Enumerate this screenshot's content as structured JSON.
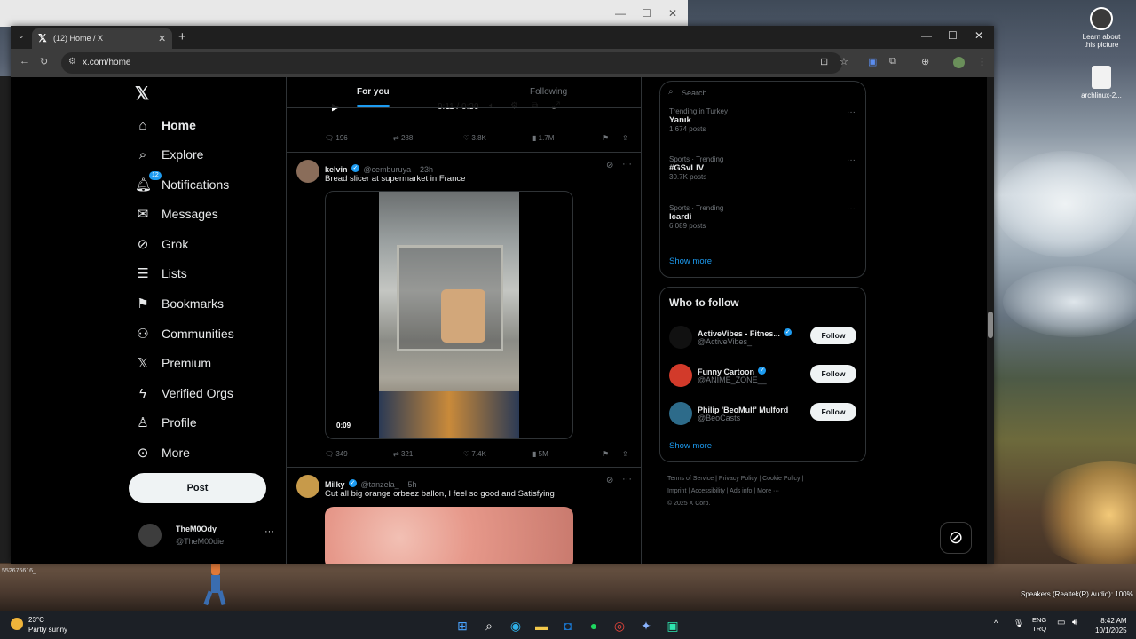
{
  "browser": {
    "tab_title": "(12) Home / X",
    "url": "x.com/home"
  },
  "nav": {
    "items": [
      {
        "label": "Home",
        "icon": "home-icon"
      },
      {
        "label": "Explore",
        "icon": "search-icon"
      },
      {
        "label": "Notifications",
        "icon": "bell-icon"
      },
      {
        "label": "Messages",
        "icon": "mail-icon"
      },
      {
        "label": "Grok",
        "icon": "grok-icon"
      },
      {
        "label": "Lists",
        "icon": "list-icon"
      },
      {
        "label": "Bookmarks",
        "icon": "bookmark-icon"
      },
      {
        "label": "Communities",
        "icon": "people-icon"
      },
      {
        "label": "Premium",
        "icon": "x-logo-icon"
      },
      {
        "label": "Verified Orgs",
        "icon": "lightning-icon"
      },
      {
        "label": "Profile",
        "icon": "person-icon"
      },
      {
        "label": "More",
        "icon": "more-circle-icon"
      }
    ],
    "notifications_badge": "12",
    "post_label": "Post",
    "account": {
      "name": "TheM0Ody",
      "handle": "@TheM00die"
    }
  },
  "timeline": {
    "tabs": [
      "For you",
      "Following"
    ],
    "top_player": {
      "time": "0:11 / 0:30"
    },
    "top_actions": {
      "replies": "196",
      "reposts": "288",
      "likes": "3.8K",
      "views": "1.7M"
    },
    "tweets": [
      {
        "name": "kelvin",
        "handle": "@cemburuya",
        "time": "· 23h",
        "text": "Bread slicer at supermarket in France",
        "video_time": "0:09",
        "actions": {
          "replies": "349",
          "reposts": "321",
          "likes": "7.4K",
          "views": "5M"
        }
      },
      {
        "name": "Milky",
        "handle": "@tanzela_",
        "time": "· 5h",
        "text": "Cut all big orange orbeez ballon, I feel so good and Satisfying"
      }
    ]
  },
  "right": {
    "search_placeholder": "Search",
    "trends": [
      {
        "meta": "Trending in Turkey",
        "name": "Yanık",
        "posts": "1,674 posts"
      },
      {
        "meta": "Sports · Trending",
        "name": "#GSvLIV",
        "posts": "30.7K posts"
      },
      {
        "meta": "Sports · Trending",
        "name": "Icardi",
        "posts": "6,089 posts"
      }
    ],
    "show_more": "Show more",
    "who_to_follow_title": "Who to follow",
    "follow_label": "Follow",
    "who_to_follow": [
      {
        "name": "ActiveVibes - Fitnes...",
        "handle": "@ActiveVibes_"
      },
      {
        "name": "Funny Cartoon",
        "handle": "@ANIME_ZONE__"
      },
      {
        "name": "Philip 'BeoMulf' Mulford",
        "handle": "@BeoCasts"
      }
    ],
    "footer": {
      "line1": "Terms of Service  |  Privacy Policy  |  Cookie Policy  |",
      "line2": "Imprint  |  Accessibility  |  Ads info  |  More ···",
      "line3": "© 2025 X Corp."
    }
  },
  "desktop": {
    "icon1_label": "Learn about this picture",
    "icon2_label": "archlinux-2...",
    "speakers": "Speakers (Realtek(R) Audio): 100%",
    "statusbar_text": "552676616_..."
  },
  "taskbar": {
    "temp": "23°C",
    "weather": "Partly sunny",
    "lang1": "ENG",
    "lang2": "TRQ",
    "time": "8:42 AM",
    "date": "10/1/2025"
  }
}
